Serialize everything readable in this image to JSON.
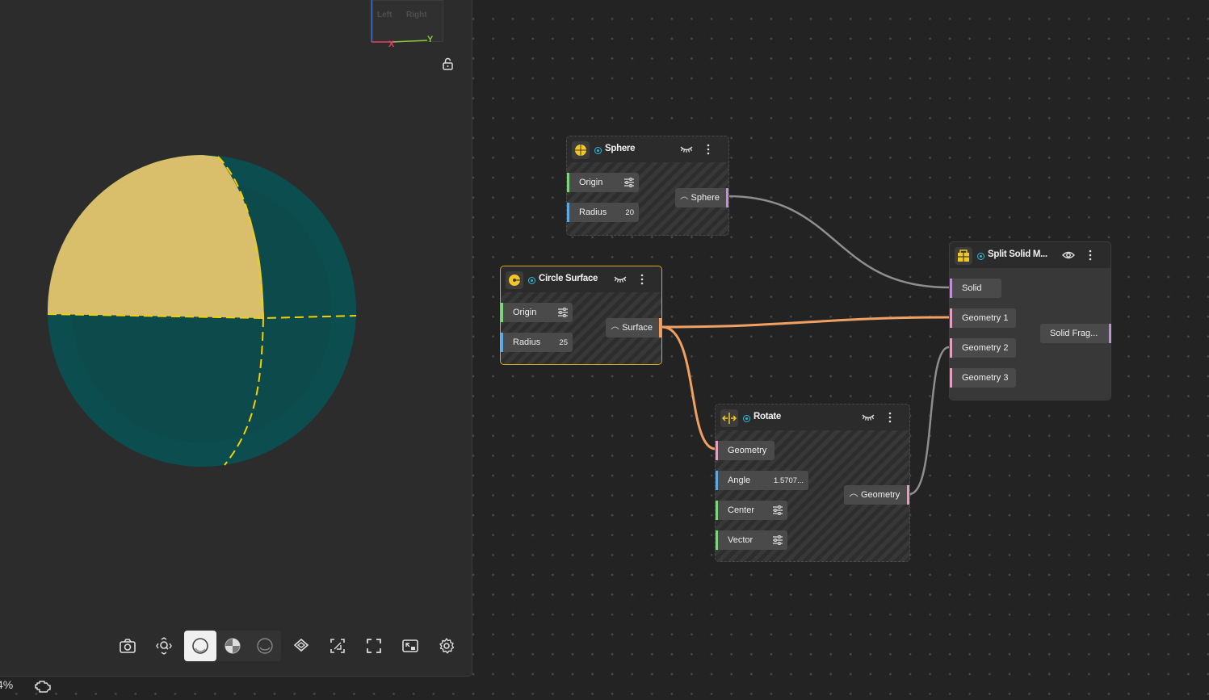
{
  "viewport": {
    "gizmo": {
      "face_left": "Left",
      "face_right": "Right",
      "axis_x": "X",
      "axis_y": "Y"
    },
    "sphere_colors": {
      "top_left": "#d9bf6b",
      "body": "#0c4a4c",
      "cut_line": "#f5d000"
    },
    "toolbar": [
      {
        "name": "camera-icon"
      },
      {
        "name": "zoom-fit-icon"
      },
      {
        "name": "shaded-icon",
        "active": true
      },
      {
        "name": "xray-icon"
      },
      {
        "name": "wireframe-icon"
      },
      {
        "name": "layers-icon"
      },
      {
        "name": "capture-icon"
      },
      {
        "name": "fullscreen-icon"
      },
      {
        "name": "picture-in-picture-icon"
      },
      {
        "name": "settings-icon"
      }
    ],
    "status": {
      "percent": "4%"
    }
  },
  "nodes": {
    "sphere": {
      "title": "Sphere",
      "inputs": [
        {
          "label": "Origin"
        },
        {
          "label": "Radius",
          "value": "20"
        }
      ],
      "output": "Sphere"
    },
    "circle_surface": {
      "title": "Circle Surface",
      "inputs": [
        {
          "label": "Origin"
        },
        {
          "label": "Radius",
          "value": "25"
        }
      ],
      "output": "Surface"
    },
    "rotate": {
      "title": "Rotate",
      "inputs": [
        {
          "label": "Geometry"
        },
        {
          "label": "Angle",
          "value": "1.5707..."
        },
        {
          "label": "Center"
        },
        {
          "label": "Vector"
        }
      ],
      "output": "Geometry"
    },
    "split_solid": {
      "title": "Split Solid M...",
      "inputs": [
        {
          "label": "Solid"
        },
        {
          "label": "Geometry 1"
        },
        {
          "label": "Geometry 2"
        },
        {
          "label": "Geometry 3"
        }
      ],
      "output": "Solid Frag..."
    }
  },
  "colors": {
    "accent_selected": "#d9a625",
    "port_vector": "#7fd37f",
    "port_number": "#5ea8e0",
    "port_geometry": "#e0a0c0",
    "port_solid": "#c28fd6",
    "wire_surface": "#f0a060",
    "wire_default": "#8e8e8e",
    "status_dot": "#2fb9d9"
  }
}
